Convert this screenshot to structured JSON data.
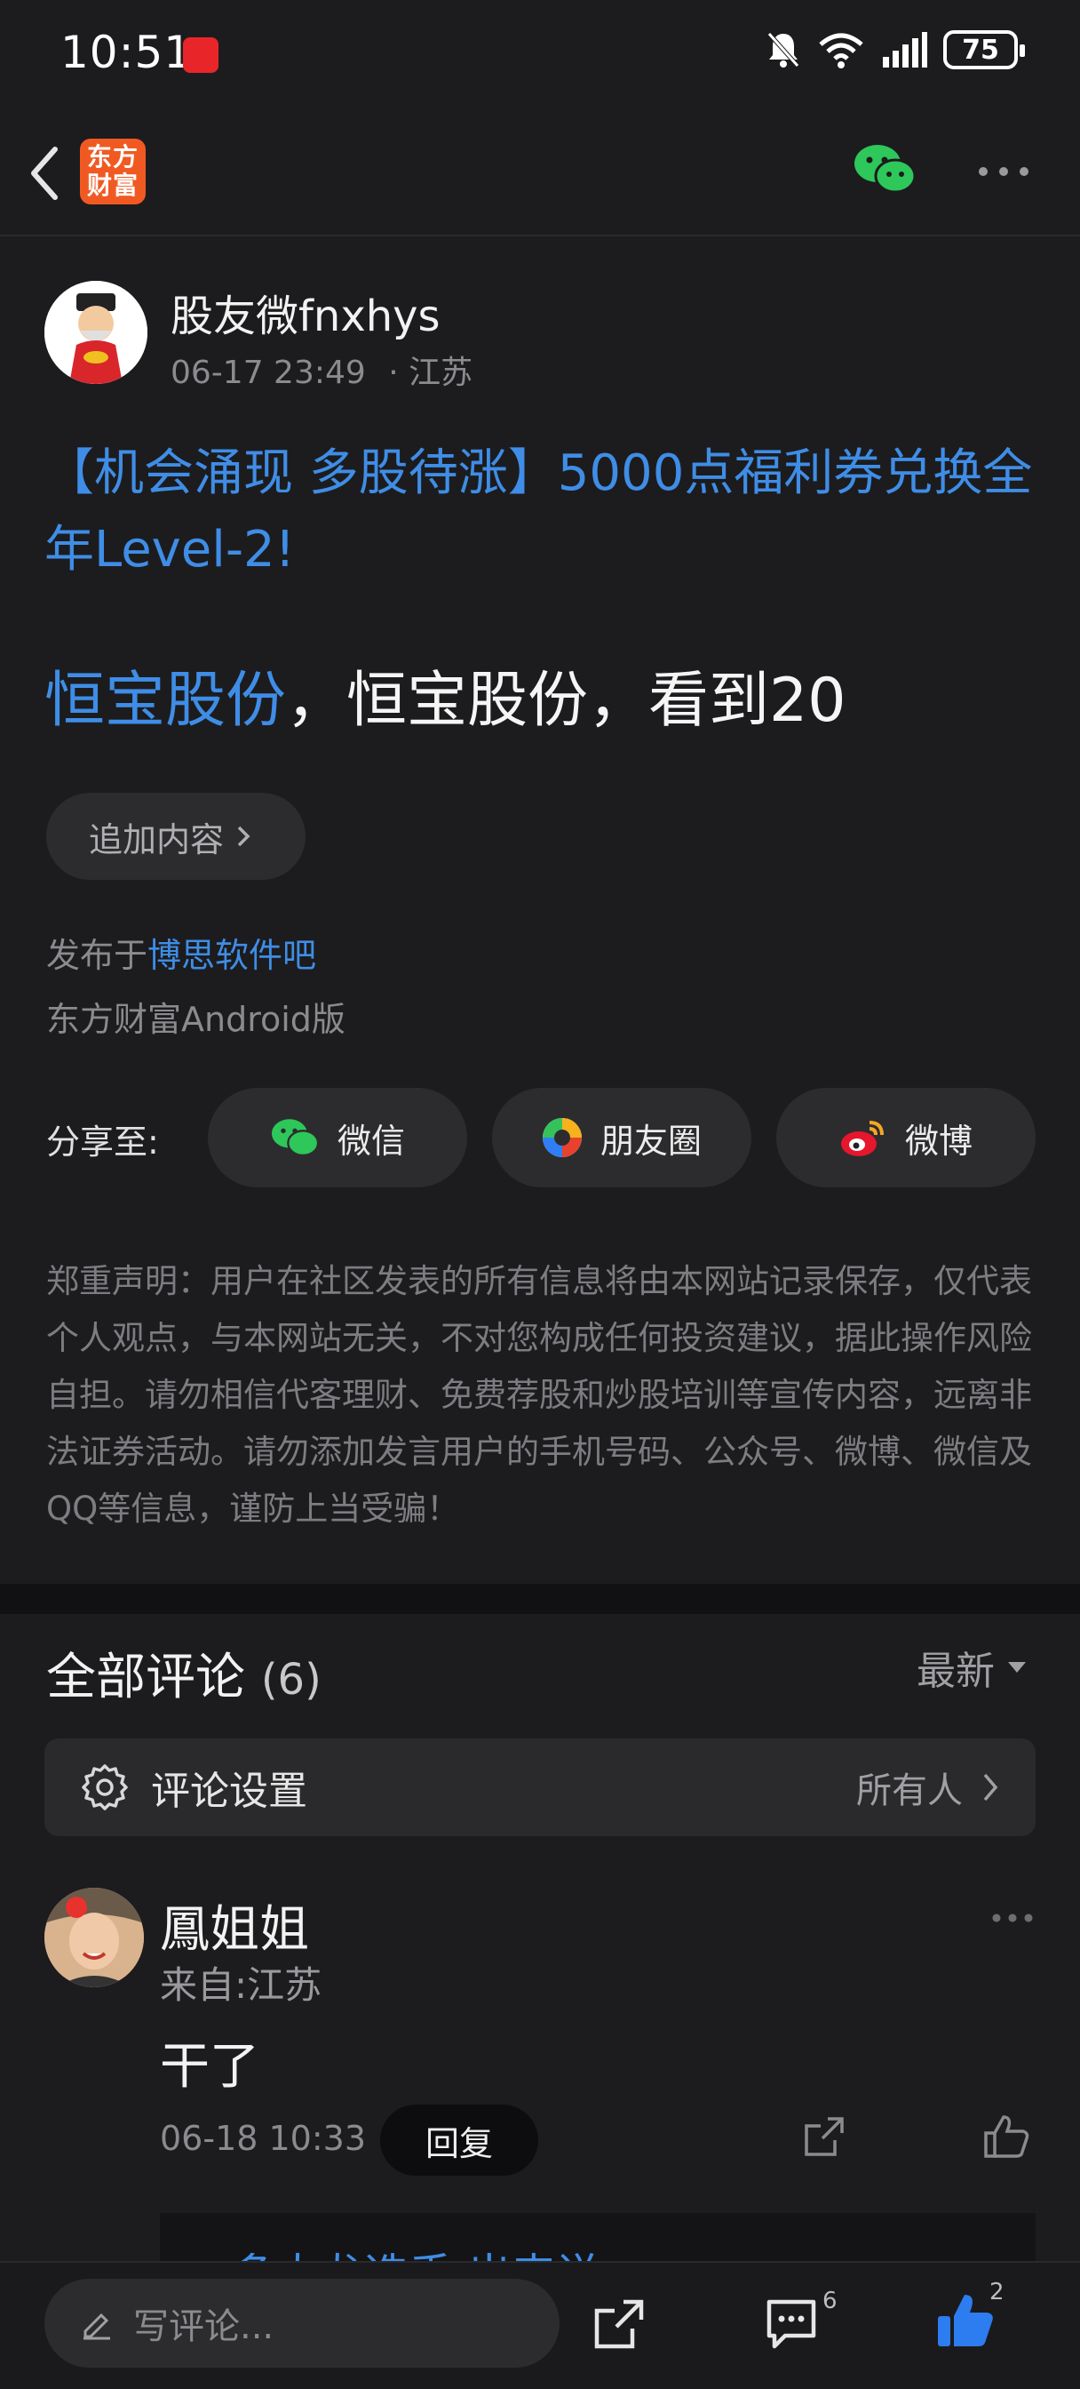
{
  "status_bar": {
    "time": "10:51",
    "battery": "75"
  },
  "nav": {
    "logo_line1": "东方",
    "logo_line2": "财富"
  },
  "post": {
    "author": "股友微fnxhys",
    "date": "06-17 23:49",
    "location": "· 江苏",
    "promo_title": "【机会涌现 多股待涨】5000点福利券兑换全年Level-2!",
    "stock_link": "恒宝股份",
    "body_rest": "，恒宝股份，看到20",
    "add_content_label": "追加内容",
    "published_prefix": "发布于",
    "published_board": "博思软件吧",
    "client": "东方财富Android版",
    "share_label": "分享至:",
    "share_wechat": "微信",
    "share_moments": "朋友圈",
    "share_weibo": "微博",
    "disclaimer": "郑重声明：用户在社区发表的所有信息将由本网站记录保存，仅代表个人观点，与本网站无关，不对您构成任何投资建议，据此操作风险自担。请勿相信代客理财、免费荐股和炒股培训等宣传内容，远离非法证券活动。请勿添加发言用户的手机号码、公众号、微博、微信及QQ等信息，谨防上当受骗！"
  },
  "comments": {
    "title": "全部评论",
    "count": "(6)",
    "sort": "最新",
    "settings_label": "评论设置",
    "settings_value": "所有人",
    "items": [
      {
        "name": "鳳姐姐",
        "from": "来自:江苏",
        "text": "干了",
        "time": "06-18 10:33",
        "reply_label": "回复"
      }
    ],
    "sub_reply_preview": "多大龙选手   出来说"
  },
  "bottom_bar": {
    "write_placeholder": "写评论...",
    "comment_count": "6",
    "like_count": "2"
  },
  "colors": {
    "link": "#3f8de6",
    "background": "#1c1c1e",
    "like": "#2d7cf0"
  }
}
